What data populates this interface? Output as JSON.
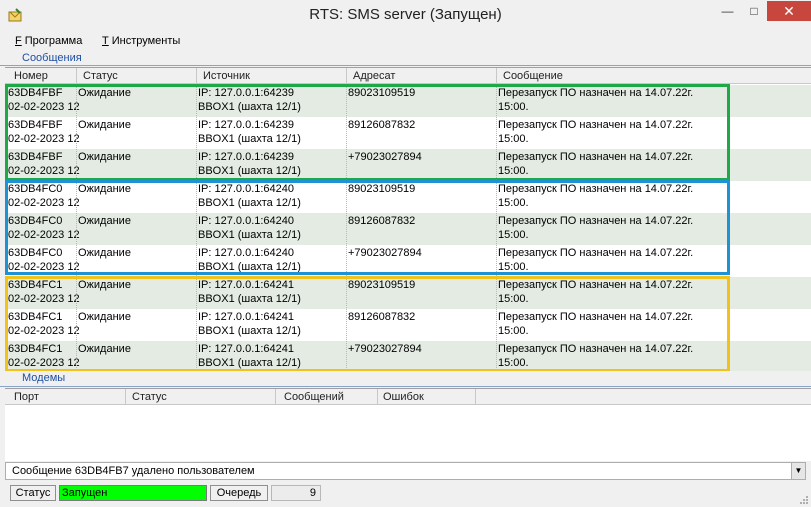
{
  "window": {
    "title": "RTS: SMS server (Запущен)",
    "minimize": "—",
    "maximize": "□",
    "close": "✕"
  },
  "menu": [
    {
      "mnemonic": "F",
      "label": "Программа"
    },
    {
      "mnemonic": "T",
      "label": "Инструменты"
    }
  ],
  "messages": {
    "section_label": "Сообщения",
    "columns": [
      "Номер",
      "Статус",
      "Источник",
      "Адресат",
      "Сообщение"
    ],
    "rows": [
      {
        "id": "63DB4FBF",
        "date": "02-02-2023 12",
        "status": "Ожидание",
        "source_ip": "IP: 127.0.0.1:64239",
        "source_box": "BBOX1 (шахта 12/1)",
        "address": "89023109519",
        "msg1": "Перезапуск ПО назначен на 14.07.22г.",
        "msg2": "15:00."
      },
      {
        "id": "63DB4FBF",
        "date": "02-02-2023 12",
        "status": "Ожидание",
        "source_ip": "IP: 127.0.0.1:64239",
        "source_box": "BBOX1 (шахта 12/1)",
        "address": "89126087832",
        "msg1": "Перезапуск ПО назначен на 14.07.22г.",
        "msg2": "15:00."
      },
      {
        "id": "63DB4FBF",
        "date": "02-02-2023 12",
        "status": "Ожидание",
        "source_ip": "IP: 127.0.0.1:64239",
        "source_box": "BBOX1 (шахта 12/1)",
        "address": "+79023027894",
        "msg1": "Перезапуск ПО назначен на 14.07.22г.",
        "msg2": "15:00."
      },
      {
        "id": "63DB4FC0",
        "date": "02-02-2023 12",
        "status": "Ожидание",
        "source_ip": "IP: 127.0.0.1:64240",
        "source_box": "BBOX1 (шахта 12/1)",
        "address": "89023109519",
        "msg1": "Перезапуск ПО назначен на 14.07.22г.",
        "msg2": "15:00."
      },
      {
        "id": "63DB4FC0",
        "date": "02-02-2023 12",
        "status": "Ожидание",
        "source_ip": "IP: 127.0.0.1:64240",
        "source_box": "BBOX1 (шахта 12/1)",
        "address": "89126087832",
        "msg1": "Перезапуск ПО назначен на 14.07.22г.",
        "msg2": "15:00."
      },
      {
        "id": "63DB4FC0",
        "date": "02-02-2023 12",
        "status": "Ожидание",
        "source_ip": "IP: 127.0.0.1:64240",
        "source_box": "BBOX1 (шахта 12/1)",
        "address": "+79023027894",
        "msg1": "Перезапуск ПО назначен на 14.07.22г.",
        "msg2": "15:00."
      },
      {
        "id": "63DB4FC1",
        "date": "02-02-2023 12",
        "status": "Ожидание",
        "source_ip": "IP: 127.0.0.1:64241",
        "source_box": "BBOX1 (шахта 12/1)",
        "address": "89023109519",
        "msg1": "Перезапуск ПО назначен на 14.07.22г.",
        "msg2": "15:00."
      },
      {
        "id": "63DB4FC1",
        "date": "02-02-2023 12",
        "status": "Ожидание",
        "source_ip": "IP: 127.0.0.1:64241",
        "source_box": "BBOX1 (шахта 12/1)",
        "address": "89126087832",
        "msg1": "Перезапуск ПО назначен на 14.07.22г.",
        "msg2": "15:00."
      },
      {
        "id": "63DB4FC1",
        "date": "02-02-2023 12",
        "status": "Ожидание",
        "source_ip": "IP: 127.0.0.1:64241",
        "source_box": "BBOX1 (шахта 12/1)",
        "address": "+79023027894",
        "msg1": "Перезапуск ПО назначен на 14.07.22г.",
        "msg2": "15:00."
      }
    ],
    "group_colors": [
      "#1fa847",
      "#1d93d6",
      "#f2c21b"
    ]
  },
  "modems": {
    "section_label": "Модемы",
    "columns": [
      "Порт",
      "Статус",
      "Сообщений",
      "Ошибок"
    ]
  },
  "log": {
    "text": "Сообщение 63DB4FB7 удалено пользователем"
  },
  "statusbar": {
    "status_label": "Статус",
    "status_value": "Запущен",
    "status_color": "#00ff00",
    "queue_label": "Очередь",
    "queue_value": "9"
  }
}
